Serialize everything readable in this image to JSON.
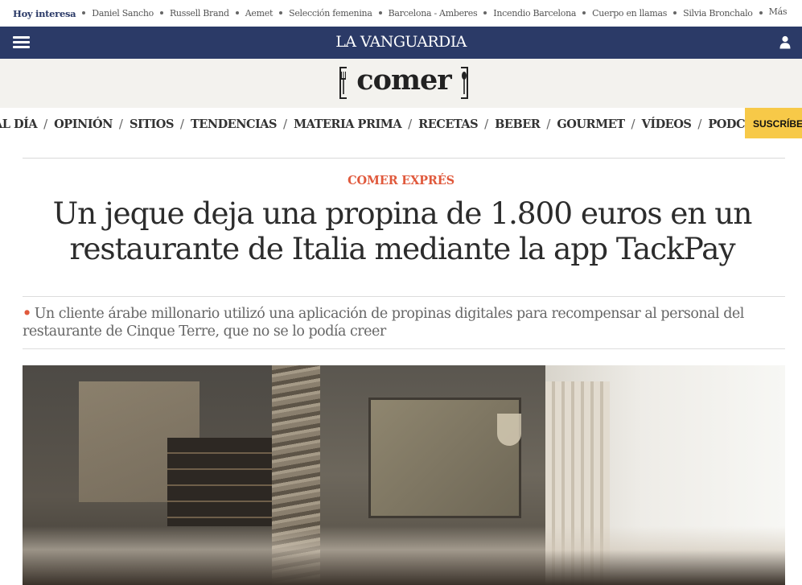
{
  "trending": {
    "lead": "Hoy interesa",
    "items": [
      "Daniel Sancho",
      "Russell Brand",
      "Aemet",
      "Selección femenina",
      "Barcelona - Amberes",
      "Incendio Barcelona",
      "Cuerpo en llamas",
      "Silvia Bronchalo",
      "Más"
    ]
  },
  "masthead": {
    "brand": "LA VANGUARDIA",
    "menu_icon": "hamburger-menu-icon",
    "user_icon": "user-icon",
    "color": "#2b3a67"
  },
  "section": {
    "logo_text": "comer",
    "logo_icon": "fork-icon"
  },
  "nav": {
    "items": [
      "AL DÍA",
      "OPINIÓN",
      "SITIOS",
      "TENDENCIAS",
      "MATERIA PRIMA",
      "RECETAS",
      "BEBER",
      "GOURMET",
      "VÍDEOS",
      "PODCAST"
    ],
    "subscribe": "SUSCRÍBE"
  },
  "article": {
    "kicker": "COMER EXPRÉS",
    "headline": "Un jeque deja una propina de 1.800 euros en un restaurante de Italia mediante la app TackPay",
    "subhead_bullet": "•",
    "subhead": "Un cliente árabe millonario utilizó una aplicación de propinas digitales para recompensar al personal del restaurante de Cinque Terre, que no se lo podía creer",
    "accent_color": "#e0593c"
  }
}
